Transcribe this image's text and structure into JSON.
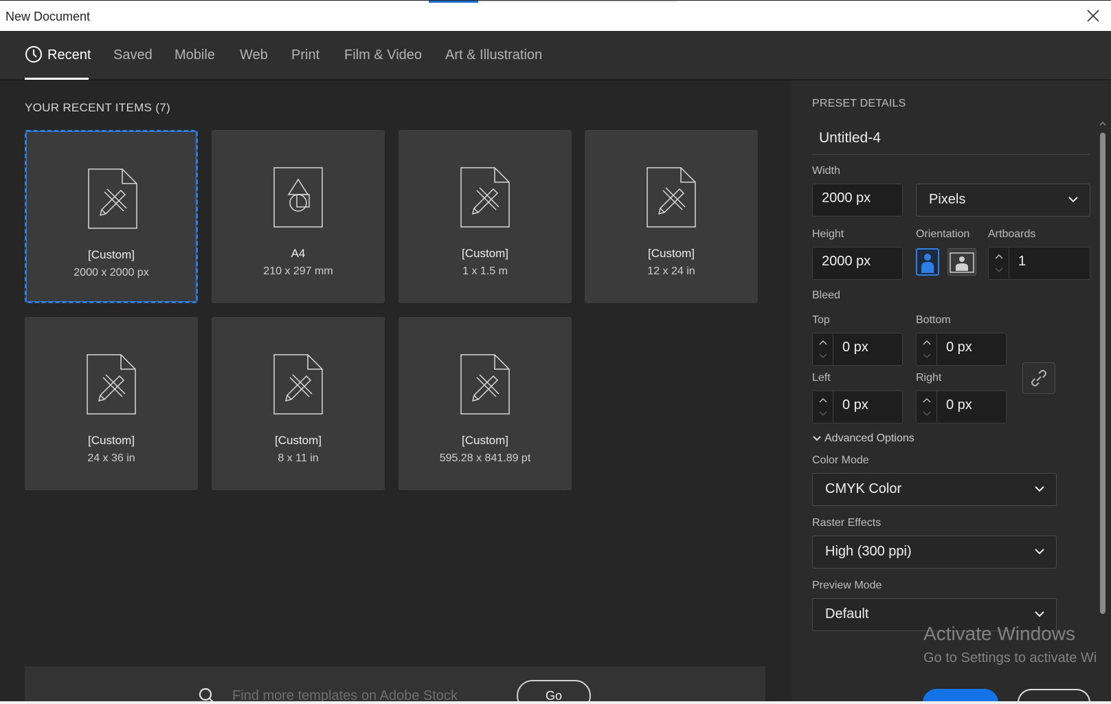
{
  "window": {
    "title": "New Document"
  },
  "tabs": [
    {
      "label": "Recent",
      "active": true
    },
    {
      "label": "Saved"
    },
    {
      "label": "Mobile"
    },
    {
      "label": "Web"
    },
    {
      "label": "Print"
    },
    {
      "label": "Film & Video"
    },
    {
      "label": "Art & Illustration"
    }
  ],
  "recent": {
    "title": "YOUR RECENT ITEMS",
    "count": "(7)",
    "items": [
      {
        "name": "[Custom]",
        "size": "2000 x 2000 px",
        "icon": "pencil-ruler-doc-icon",
        "selected": true
      },
      {
        "name": "A4",
        "size": "210 x 297 mm",
        "icon": "shapes-doc-icon"
      },
      {
        "name": "[Custom]",
        "size": "1 x 1.5 m",
        "icon": "pencil-ruler-doc-icon"
      },
      {
        "name": "[Custom]",
        "size": "12 x 24 in",
        "icon": "pencil-ruler-doc-icon"
      },
      {
        "name": "[Custom]",
        "size": "24 x 36 in",
        "icon": "pencil-ruler-doc-icon"
      },
      {
        "name": "[Custom]",
        "size": "8 x 11 in",
        "icon": "pencil-ruler-doc-icon"
      },
      {
        "name": "[Custom]",
        "size": "595.28 x 841.89 pt",
        "icon": "pencil-ruler-doc-icon"
      }
    ]
  },
  "stock": {
    "placeholder": "Find more templates on Adobe Stock",
    "go_label": "Go"
  },
  "preset": {
    "heading": "PRESET DETAILS",
    "doc_name": "Untitled-4",
    "width_label": "Width",
    "width_value": "2000 px",
    "units": "Pixels",
    "height_label": "Height",
    "height_value": "2000 px",
    "orientation_label": "Orientation",
    "orientation": "portrait",
    "artboards_label": "Artboards",
    "artboards_value": "1",
    "bleed_label": "Bleed",
    "bleed": {
      "top_label": "Top",
      "top": "0 px",
      "bottom_label": "Bottom",
      "bottom": "0 px",
      "left_label": "Left",
      "left": "0 px",
      "right_label": "Right",
      "right": "0 px"
    },
    "advanced_label": "Advanced Options",
    "color_mode_label": "Color Mode",
    "color_mode": "CMYK Color",
    "raster_label": "Raster Effects",
    "raster": "High (300 ppi)",
    "preview_label": "Preview Mode",
    "preview": "Default"
  },
  "watermark": {
    "line1": "Activate Windows",
    "line2": "Go to Settings to activate Wi"
  },
  "colors": {
    "accent": "#2d7fe8",
    "panel_bg": "#262626",
    "card_bg": "#3b3b3b",
    "create_button": "#1473e6"
  }
}
